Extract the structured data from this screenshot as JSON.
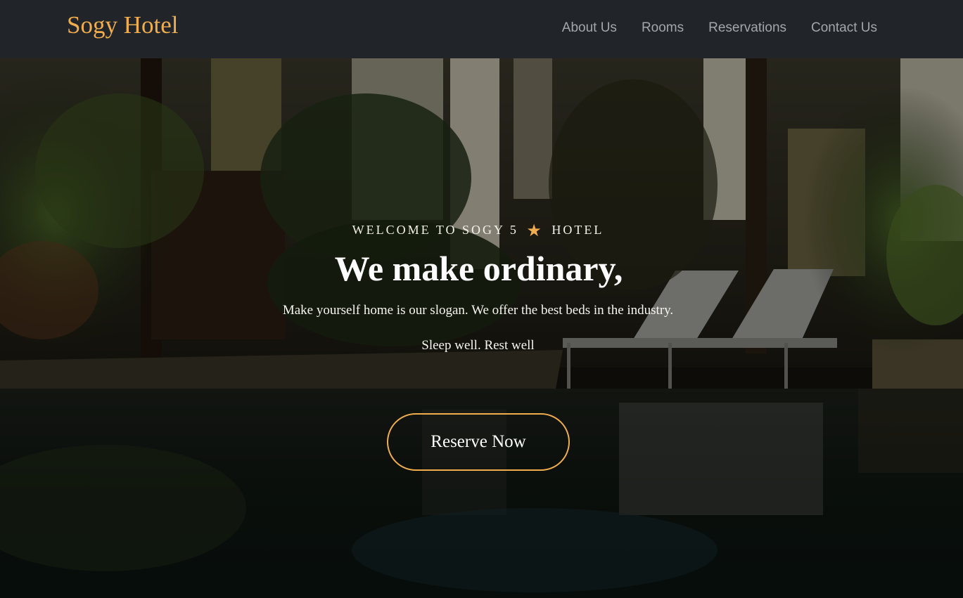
{
  "navbar": {
    "brand": "Sogy Hotel",
    "links": [
      "About Us",
      "Rooms",
      "Reservations",
      "Contact Us"
    ]
  },
  "hero": {
    "welcome_prefix": "WELCOME TO SOGY 5",
    "welcome_star": "★",
    "welcome_suffix": "HOTEL",
    "headline": "We make ordinary,",
    "tagline": "Make yourself home is our slogan. We offer the best beds in the industry.",
    "subtag": "Sleep well. Rest well",
    "button_label": "Reserve Now"
  },
  "colors": {
    "accent": "#f0ad4e",
    "navbar_bg": "#212529",
    "nav_link": "#a3a6aa"
  }
}
